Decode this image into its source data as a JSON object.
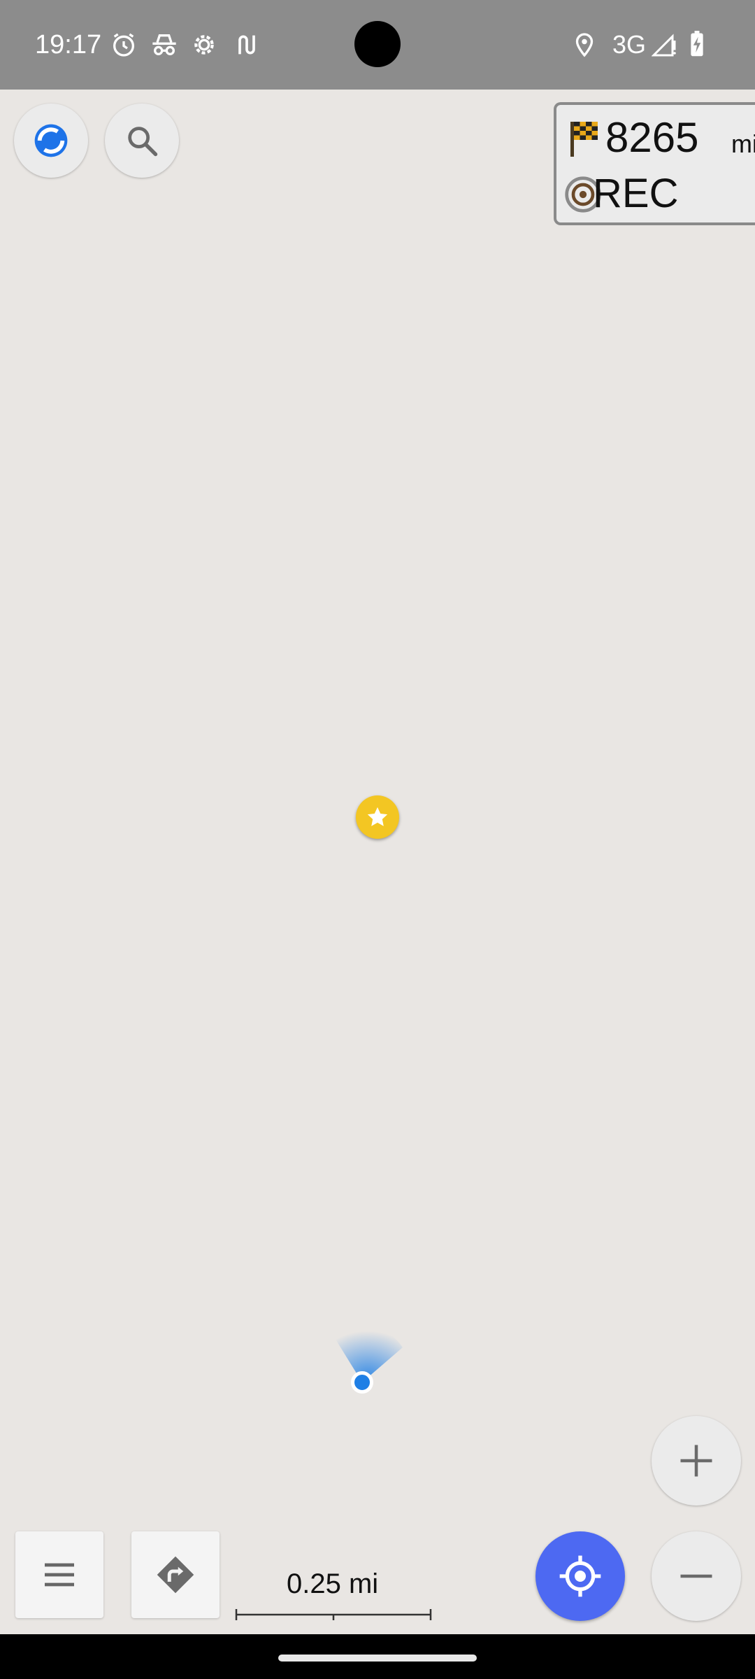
{
  "status_bar": {
    "time": "19:17",
    "icons": [
      "alarm-icon",
      "incognito-icon",
      "settings-gear-icon",
      "route-sync-icon"
    ],
    "right_icons": [
      "location-icon",
      "signal-icon",
      "battery-charging-icon"
    ],
    "network": "3G"
  },
  "map": {
    "distance_widget": {
      "value": "8265",
      "unit": "mi",
      "icon": "checkered-flag-icon"
    },
    "rec_widget": {
      "label": "REC",
      "icon": "record-target-icon"
    },
    "favorite_icon": "star-icon",
    "scale": {
      "label": "0.25 mi"
    }
  },
  "controls": {
    "compass_icon": "compass-icon",
    "search_icon": "search-icon",
    "menu_icon": "menu-icon",
    "route_icon": "directions-icon",
    "zoom_in_icon": "plus-icon",
    "zoom_out_icon": "minus-icon",
    "my_location_icon": "my-location-icon"
  },
  "colors": {
    "map_background": "#e9e6e3",
    "status_bar": "#8c8c8c",
    "accent_blue": "#4d69f2",
    "location_blue": "#1f7fe5",
    "favorite_yellow": "#f3c623"
  }
}
